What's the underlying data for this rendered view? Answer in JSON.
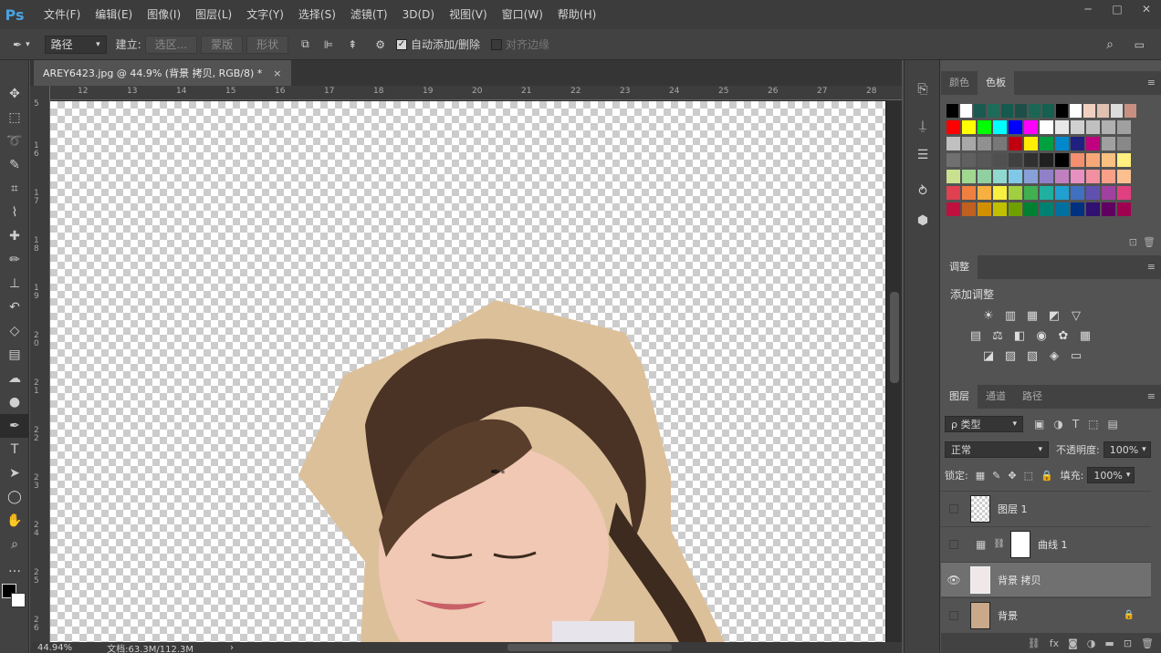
{
  "app": {
    "logo": "Ps"
  },
  "menubar": {
    "items": [
      "文件(F)",
      "编辑(E)",
      "图像(I)",
      "图层(L)",
      "文字(Y)",
      "选择(S)",
      "滤镜(T)",
      "3D(D)",
      "视图(V)",
      "窗口(W)",
      "帮助(H)"
    ],
    "window_controls": [
      "minimize-icon",
      "restore-icon",
      "close-icon"
    ]
  },
  "options": {
    "mode_value": "路径",
    "build_label": "建立:",
    "selection_btn": "选区...",
    "mask_btn": "蒙版",
    "shape_btn": "形状",
    "auto_add_delete": "自动添加/删除",
    "align_edges": "对齐边缘"
  },
  "document": {
    "tab_title": "AREY6423.jpg @ 44.9% (背景 拷贝, RGB/8) *",
    "tab_close": "×",
    "h_ruler": [
      "12",
      "13",
      "14",
      "15",
      "16",
      "17",
      "18",
      "19",
      "20",
      "21",
      "22",
      "23",
      "24",
      "25",
      "26",
      "27",
      "28"
    ],
    "v_ruler": [
      "5",
      "16",
      "17",
      "18",
      "19",
      "20",
      "21",
      "22",
      "23",
      "24",
      "25",
      "26"
    ],
    "zoom": "44.94%",
    "doc_info": "文档:63.3M/112.3M"
  },
  "panels": {
    "color_tabs": [
      "颜色",
      "色板"
    ],
    "swatch_colors": [
      [
        "#000000",
        "#ffffff",
        "#1a5a50",
        "#1f6b5a",
        "#155a4e",
        "#1d4f48",
        "#1b6655",
        "#156050",
        "#000000",
        "#ffffff",
        "#f0d0c0",
        "#e0c0b0",
        "#dcdcdc",
        "#c89080"
      ],
      [
        "#ff0000",
        "#ffff00",
        "#00ff00",
        "#00ffff",
        "#0000ff",
        "#ff00ff",
        "#ffffff",
        "#e8e8e8",
        "#d0d0d0",
        "#c0c0c0",
        "#b0b0b0",
        "#a0a0a0"
      ],
      [
        "#c0c0c0",
        "#a8a8a8",
        "#909090",
        "#787878",
        "#c00010",
        "#ffee00",
        "#00a040",
        "#0088cc",
        "#202080",
        "#c00080",
        "#a0a0a0",
        "#888888"
      ],
      [
        "#707070",
        "#606060",
        "#585858",
        "#505050",
        "#404040",
        "#303030",
        "#202020",
        "#000000",
        "#f49070",
        "#f8a878",
        "#fac080",
        "#fff080"
      ],
      [
        "#c8e090",
        "#a0d890",
        "#90d0a0",
        "#90d8d0",
        "#80c8e8",
        "#88a0d8",
        "#9080c8",
        "#c080c0",
        "#e890c0",
        "#f090a0",
        "#f8a088",
        "#fcc090"
      ],
      [
        "#e04050",
        "#f08040",
        "#f8b040",
        "#f8f040",
        "#a0d040",
        "#40b050",
        "#20b0a0",
        "#20a0d0",
        "#4070c0",
        "#6050b0",
        "#a040a0",
        "#e04080"
      ],
      [
        "#c01040",
        "#c06020",
        "#d09000",
        "#c0c000",
        "#70a000",
        "#008030",
        "#008070",
        "#0070a0",
        "#003080",
        "#301070",
        "#600060",
        "#a00050"
      ]
    ],
    "adjust_tab": "调整",
    "adjust_title": "添加调整",
    "adjust_icons": [
      [
        "brightness-icon",
        "levels-icon",
        "curves-icon",
        "exposure-icon",
        "vibrance-icon"
      ],
      [
        "hue-icon",
        "balance-icon",
        "bw-icon",
        "photo-filter-icon",
        "mixer-icon",
        "lookup-icon"
      ],
      [
        "invert-icon",
        "posterize-icon",
        "threshold-icon",
        "selective-color-icon",
        "gradient-map-icon"
      ]
    ],
    "layer_tabs": [
      "图层",
      "通道",
      "路径"
    ],
    "layer_filter": "ρ 类型",
    "blend_mode": "正常",
    "opacity_label": "不透明度:",
    "opacity_value": "100%",
    "lock_label": "锁定:",
    "fill_label": "填充:",
    "fill_value": "100%",
    "layers": [
      {
        "name": "图层 1",
        "visible": false,
        "selected": false
      },
      {
        "name": "曲线 1",
        "visible": false,
        "selected": false
      },
      {
        "name": "背景 拷贝",
        "visible": true,
        "selected": true
      },
      {
        "name": "背景",
        "visible": false,
        "selected": false
      }
    ],
    "bottom_icons": [
      "link-icon",
      "fx-icon",
      "mask-icon",
      "adjust-icon",
      "folder-icon",
      "new-layer-icon",
      "trash-icon"
    ]
  },
  "colors": {
    "accent": "#4aa3df",
    "skin": "#dcc09a"
  }
}
